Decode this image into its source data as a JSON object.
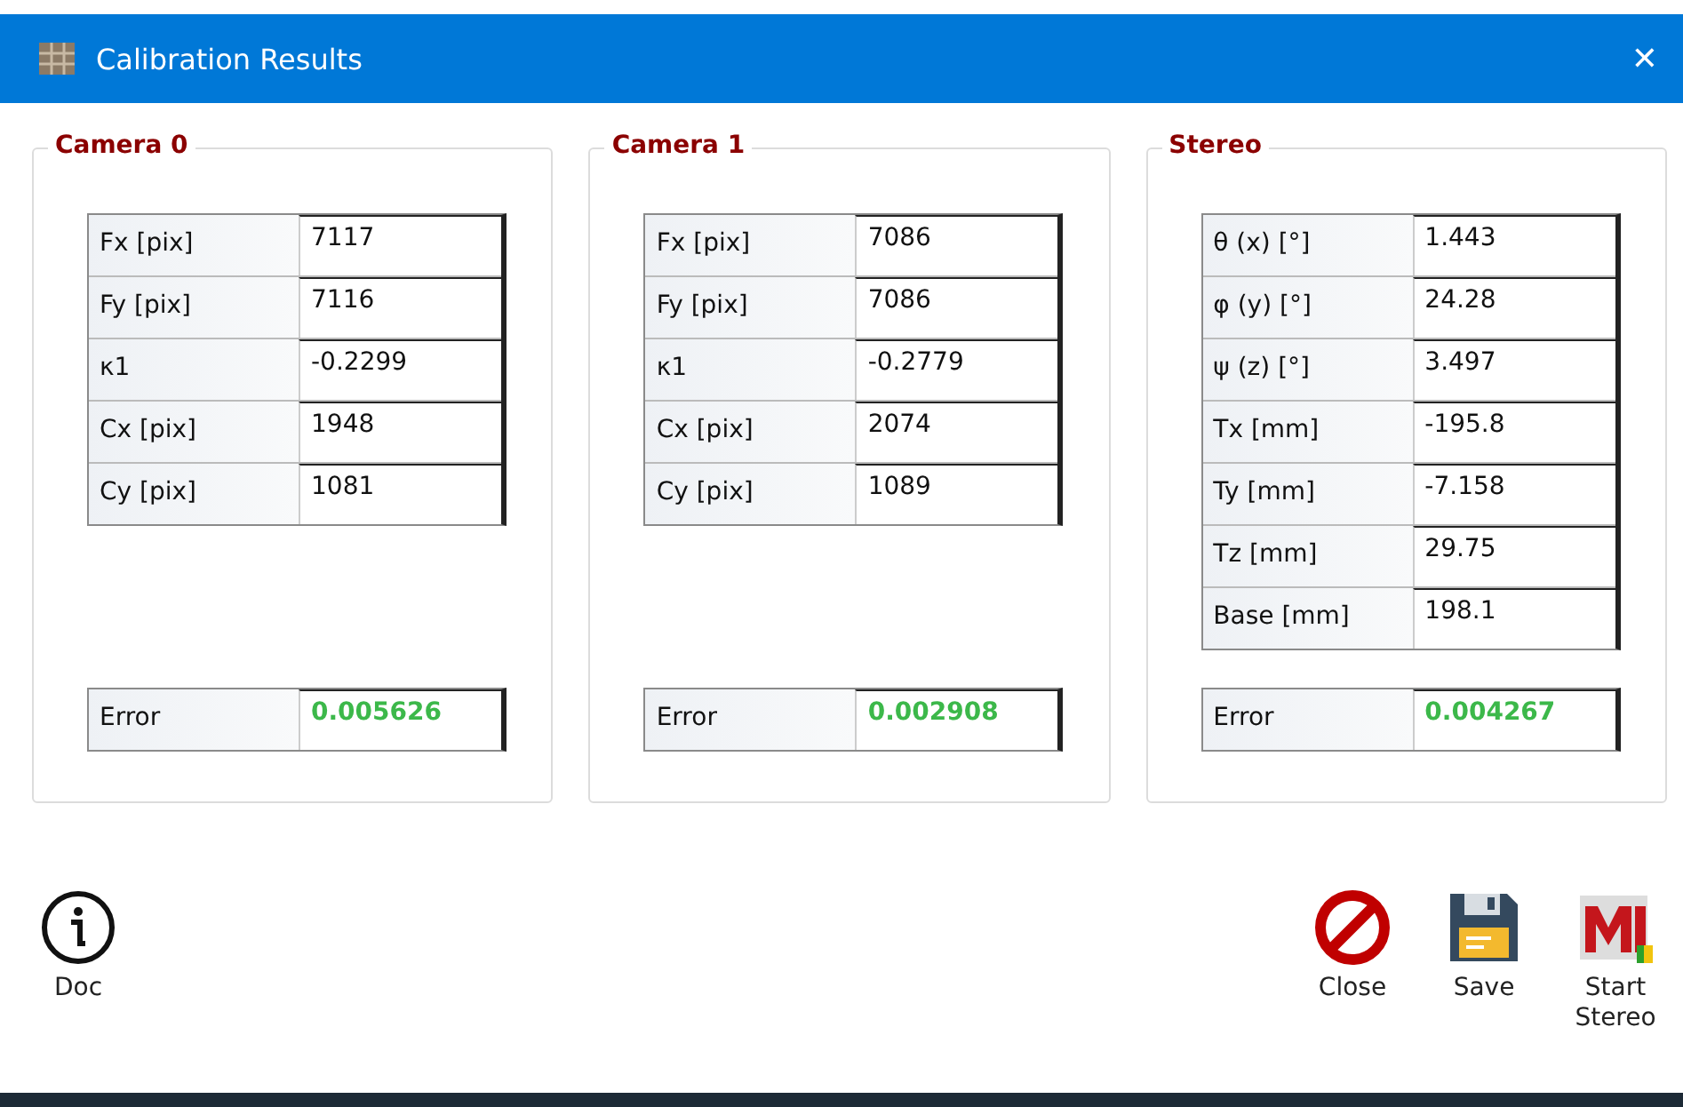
{
  "window": {
    "title": "Calibration Results",
    "close": "✕"
  },
  "groups": [
    {
      "title": "Camera 0",
      "rows": [
        {
          "label": "Fx [pix]",
          "value": "7117"
        },
        {
          "label": "Fy [pix]",
          "value": "7116"
        },
        {
          "label": "κ1",
          "value": "-0.2299"
        },
        {
          "label": "Cx [pix]",
          "value": "1948"
        },
        {
          "label": "Cy [pix]",
          "value": "1081"
        }
      ],
      "error": {
        "label": "Error",
        "value": "0.005626"
      }
    },
    {
      "title": "Camera 1",
      "rows": [
        {
          "label": "Fx [pix]",
          "value": "7086"
        },
        {
          "label": "Fy [pix]",
          "value": "7086"
        },
        {
          "label": "κ1",
          "value": "-0.2779"
        },
        {
          "label": "Cx [pix]",
          "value": "2074"
        },
        {
          "label": "Cy [pix]",
          "value": "1089"
        }
      ],
      "error": {
        "label": "Error",
        "value": "0.002908"
      }
    },
    {
      "title": "Stereo",
      "rows": [
        {
          "label": "θ (x) [°]",
          "value": "1.443"
        },
        {
          "label": "φ (y) [°]",
          "value": "24.28"
        },
        {
          "label": "ψ (z) [°]",
          "value": "3.497"
        },
        {
          "label": "Tx [mm]",
          "value": "-195.8"
        },
        {
          "label": "Ty [mm]",
          "value": "-7.158"
        },
        {
          "label": "Tz [mm]",
          "value": "29.75"
        },
        {
          "label": "Base [mm]",
          "value": "198.1"
        }
      ],
      "error": {
        "label": "Error",
        "value": "0.004267"
      }
    }
  ],
  "buttons": [
    {
      "kind": "doc",
      "label": "Doc"
    },
    {
      "kind": "close",
      "label": "Close"
    },
    {
      "kind": "save",
      "label": "Save"
    },
    {
      "kind": "stereo",
      "label": "Start Stereo"
    }
  ]
}
